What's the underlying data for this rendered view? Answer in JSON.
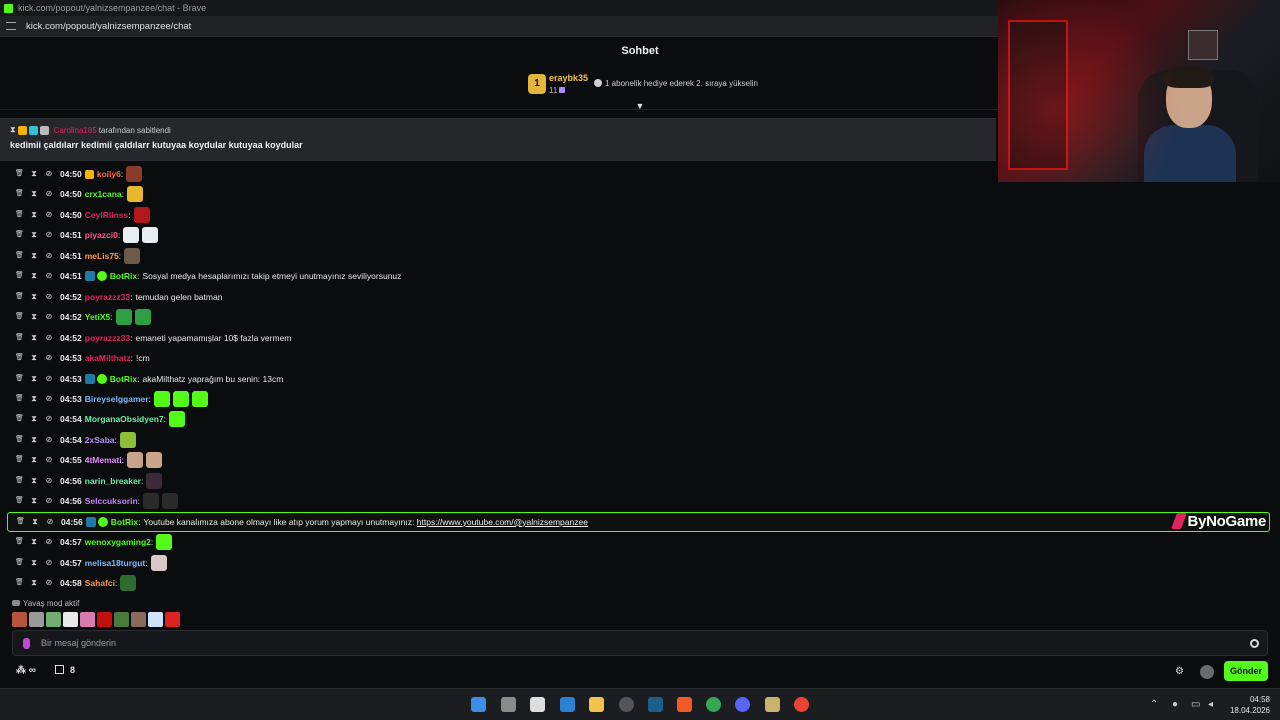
{
  "browser": {
    "title": "kick.com/popout/yalnizsempanzee/chat - Brave",
    "url": "kick.com/popout/yalnizsempanzee/chat"
  },
  "chat": {
    "header": "Sohbet",
    "sub_banner": {
      "rank": "1",
      "username": "eraybk35",
      "count": "11",
      "message": "1 abonelik hediye ederek 2. sıraya yükselin"
    },
    "pinned": {
      "pinned_by_user": "Carolina185",
      "pinned_by_suffix": "tarafından sabitlendi",
      "text": "kedimii çaldılarr kedimii çaldılarr kutuyaa koydular kutuyaa koydular"
    },
    "messages": [
      {
        "time": "04:50",
        "user": "koily6",
        "color": "#ff6b3d",
        "text": "",
        "badges": [
          "role"
        ],
        "emotes": [
          "#8a3b2a"
        ]
      },
      {
        "time": "04:50",
        "user": "crx1cana",
        "color": "#53fc18",
        "text": "",
        "badges": [],
        "emotes": [
          "#e8b92e"
        ]
      },
      {
        "time": "04:50",
        "user": "CeylRiinss",
        "color": "#e0245e",
        "text": "",
        "badges": [],
        "emotes": [
          "#b11a1a"
        ]
      },
      {
        "time": "04:51",
        "user": "piyazci0",
        "color": "#ff5a8a",
        "text": "",
        "badges": [],
        "emotes": [
          "#e9eef5",
          "#e9eef5"
        ]
      },
      {
        "time": "04:51",
        "user": "meLis75",
        "color": "#ff9a3c",
        "text": "",
        "badges": [],
        "emotes": [
          "#6b5a4a"
        ]
      },
      {
        "time": "04:51",
        "user": "BotRix",
        "color": "#53fc18",
        "text": "Sosyal medya hesaplarımızı takip etmeyi unutmayınız seviliyorsunuz",
        "badges": [
          "bot",
          "verify"
        ],
        "emotes": []
      },
      {
        "time": "04:52",
        "user": "poyrazzz33",
        "color": "#e0245e",
        "text": "temudan gelen batman",
        "badges": [],
        "emotes": []
      },
      {
        "time": "04:52",
        "user": "YetiX5",
        "color": "#53fc18",
        "text": "",
        "badges": [],
        "emotes": [
          "#2ea043",
          "#2ea043"
        ]
      },
      {
        "time": "04:52",
        "user": "poyrazzz33",
        "color": "#e0245e",
        "text": "emaneti yapamamışlar 10$ fazla vermem",
        "badges": [],
        "emotes": []
      },
      {
        "time": "04:53",
        "user": "akaMilthatz",
        "color": "#e0245e",
        "text": "!cm",
        "badges": [],
        "emotes": []
      },
      {
        "time": "04:53",
        "user": "BotRix",
        "color": "#53fc18",
        "text": "akaMilthatz yaprağım bu senin: 13cm",
        "badges": [
          "bot",
          "verify"
        ],
        "emotes": []
      },
      {
        "time": "04:53",
        "user": "Bireyselggamer",
        "color": "#7ab8ff",
        "text": "",
        "badges": [],
        "emotes": [
          "#53fc18",
          "#53fc18",
          "#53fc18"
        ]
      },
      {
        "time": "04:54",
        "user": "MorganaObsidyen7",
        "color": "#6ef0a8",
        "text": "",
        "badges": [],
        "emotes": [
          "#53fc18"
        ]
      },
      {
        "time": "04:54",
        "user": "2xSaba",
        "color": "#b48cff",
        "text": "",
        "badges": [],
        "emotes": [
          "#8fbf3a"
        ]
      },
      {
        "time": "04:55",
        "user": "4tMemati",
        "color": "#e58cff",
        "text": "",
        "badges": [],
        "emotes": [
          "#c9a488",
          "#c9a488"
        ]
      },
      {
        "time": "04:56",
        "user": "narin_breaker",
        "color": "#6ef0a8",
        "text": "",
        "badges": [],
        "emotes": [
          "#3a2a3a"
        ]
      },
      {
        "time": "04:56",
        "user": "Selccuksorin",
        "color": "#c77dff",
        "text": "",
        "badges": [],
        "emotes": [
          "#2a2a2a",
          "#2a2a2a"
        ]
      },
      {
        "time": "04:56",
        "user": "BotRix",
        "color": "#53fc18",
        "text": "Youtube kanalımıza abone olmayı like atıp yorum yapmayı unutmayınız: ",
        "link": "https://www.youtube.com/@yalnizsempanzee",
        "badges": [
          "bot",
          "verify"
        ],
        "emotes": [],
        "highlight": true
      },
      {
        "time": "04:57",
        "user": "wenoxygaming2",
        "color": "#53fc18",
        "text": "",
        "badges": [],
        "emotes": [
          "#53fc18"
        ]
      },
      {
        "time": "04:57",
        "user": "melisa18turgut",
        "color": "#7ab8ff",
        "text": "",
        "badges": [],
        "emotes": [
          "#d8c8c8"
        ]
      },
      {
        "time": "04:58",
        "user": "Sahafci",
        "color": "#ff9a3c",
        "text": "",
        "badges": [],
        "emotes": [
          "#2f6b2f"
        ]
      }
    ],
    "sponsor": "ByNoGame",
    "slow_mode": "Yavaş mod aktif",
    "input_placeholder": "Bir mesaj gönderin",
    "points": "∞",
    "gifts": "8",
    "send_label": "Gönder"
  },
  "emote_bar": [
    "#b5543a",
    "#9a9a9a",
    "#6fae6f",
    "#e9e9e9",
    "#d87ab0",
    "#c01010",
    "#4a7a3a",
    "#8a6a5a",
    "#cfe3ff",
    "#d22"
  ],
  "taskbar": {
    "time": "04:58",
    "date": "18.04.2026"
  },
  "colors": {
    "accent": "#53fc18",
    "background": "#0b0c0e"
  }
}
